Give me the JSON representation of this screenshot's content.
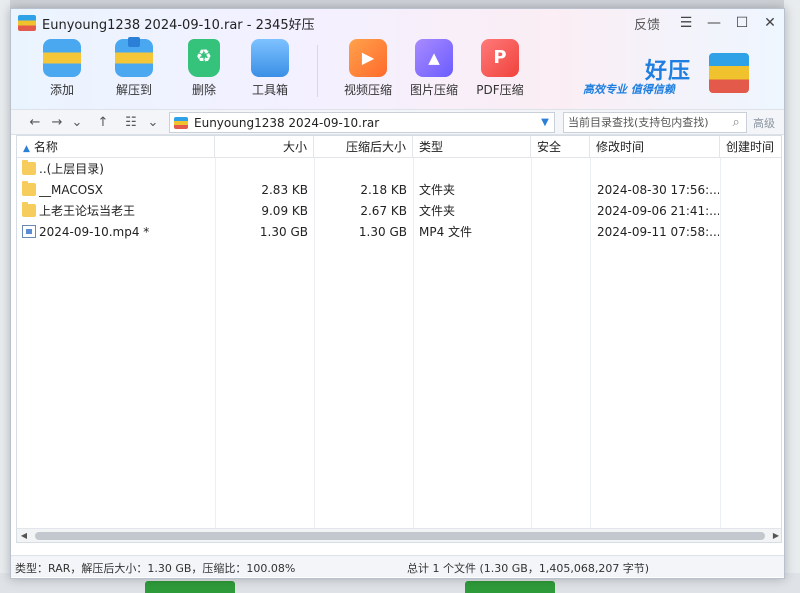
{
  "window": {
    "title": "Eunyoung1238 2024-09-10.rar - 2345好压",
    "feedback_label": "反馈",
    "menu_icon": "hamburger-icon",
    "minimize_icon": "minimize-icon",
    "maximize_icon": "maximize-icon",
    "close_icon": "close-icon"
  },
  "toolbar": {
    "items": [
      {
        "label": "添加",
        "icon": "add-archive-icon"
      },
      {
        "label": "解压到",
        "icon": "extract-icon"
      },
      {
        "label": "删除",
        "icon": "recycle-delete-icon"
      },
      {
        "label": "工具箱",
        "icon": "toolbox-icon"
      },
      {
        "label": "视频压缩",
        "icon": "video-compress-icon"
      },
      {
        "label": "图片压缩",
        "icon": "image-compress-icon"
      },
      {
        "label": "PDF压缩",
        "icon": "pdf-compress-icon"
      }
    ],
    "brand_name": "好压",
    "brand_slogan": "高效专业  值得信赖"
  },
  "addressbar": {
    "path": "Eunyoung1238 2024-09-10.rar",
    "search_placeholder": "当前目录查找(支持包内查找)",
    "advanced_label": "高级"
  },
  "columns": [
    "名称",
    "大小",
    "压缩后大小",
    "类型",
    "安全",
    "修改时间",
    "创建时间"
  ],
  "files": [
    {
      "name": "..(上层目录)",
      "size": "",
      "packed": "",
      "type": "",
      "security": "",
      "modified": "",
      "created": "",
      "kind": "folder"
    },
    {
      "name": "__MACOSX",
      "size": "2.83 KB",
      "packed": "2.18 KB",
      "type": "文件夹",
      "security": "",
      "modified": "2024-08-30 17:56:...",
      "created": "",
      "kind": "folder"
    },
    {
      "name": "上老王论坛当老王",
      "size": "9.09 KB",
      "packed": "2.67 KB",
      "type": "文件夹",
      "security": "",
      "modified": "2024-09-06 21:41:...",
      "created": "",
      "kind": "folder"
    },
    {
      "name": "2024-09-10.mp4 *",
      "size": "1.30 GB",
      "packed": "1.30 GB",
      "type": "MP4 文件",
      "security": "",
      "modified": "2024-09-11 07:58:...",
      "created": "",
      "kind": "file"
    }
  ],
  "status": {
    "left": "类型：RAR，解压后大小：1.30 GB，压缩比：100.08%",
    "mid": "总计 1 个文件 (1.30 GB，1,405,068,207 字节)"
  }
}
